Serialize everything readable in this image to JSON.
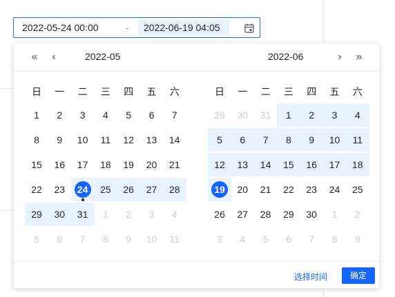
{
  "input": {
    "start": "2022-05-24 00:00",
    "separator": "-",
    "end": "2022-06-19 04:05"
  },
  "nav": {
    "prev_year": "«",
    "prev_month": "‹",
    "next_month": "›",
    "next_year": "»"
  },
  "left_calendar": {
    "title": "2022-05",
    "weekdays": [
      "日",
      "一",
      "二",
      "三",
      "四",
      "五",
      "六"
    ],
    "weeks": [
      [
        {
          "d": "1"
        },
        {
          "d": "2"
        },
        {
          "d": "3"
        },
        {
          "d": "4"
        },
        {
          "d": "5"
        },
        {
          "d": "6"
        },
        {
          "d": "7"
        }
      ],
      [
        {
          "d": "8"
        },
        {
          "d": "9"
        },
        {
          "d": "10"
        },
        {
          "d": "11"
        },
        {
          "d": "12"
        },
        {
          "d": "13"
        },
        {
          "d": "14"
        }
      ],
      [
        {
          "d": "15"
        },
        {
          "d": "16"
        },
        {
          "d": "17"
        },
        {
          "d": "18"
        },
        {
          "d": "19"
        },
        {
          "d": "20"
        },
        {
          "d": "21"
        }
      ],
      [
        {
          "d": "22"
        },
        {
          "d": "23"
        },
        {
          "d": "24",
          "selected": true,
          "today": true
        },
        {
          "d": "25",
          "range": true
        },
        {
          "d": "26",
          "range": true
        },
        {
          "d": "27",
          "range": true
        },
        {
          "d": "28",
          "range": true
        }
      ],
      [
        {
          "d": "29",
          "range": true
        },
        {
          "d": "30",
          "range": true
        },
        {
          "d": "31",
          "range": true
        },
        {
          "d": "1",
          "muted": true
        },
        {
          "d": "2",
          "muted": true
        },
        {
          "d": "3",
          "muted": true
        },
        {
          "d": "4",
          "muted": true
        }
      ],
      [
        {
          "d": "5",
          "muted": true
        },
        {
          "d": "6",
          "muted": true
        },
        {
          "d": "7",
          "muted": true
        },
        {
          "d": "8",
          "muted": true
        },
        {
          "d": "9",
          "muted": true
        },
        {
          "d": "10",
          "muted": true
        },
        {
          "d": "11",
          "muted": true
        }
      ]
    ]
  },
  "right_calendar": {
    "title": "2022-06",
    "weekdays": [
      "日",
      "一",
      "二",
      "三",
      "四",
      "五",
      "六"
    ],
    "weeks": [
      [
        {
          "d": "29",
          "muted": true
        },
        {
          "d": "30",
          "muted": true
        },
        {
          "d": "31",
          "muted": true
        },
        {
          "d": "1",
          "range": true
        },
        {
          "d": "2",
          "range": true
        },
        {
          "d": "3",
          "range": true
        },
        {
          "d": "4",
          "range": true
        }
      ],
      [
        {
          "d": "5",
          "range": true
        },
        {
          "d": "6",
          "range": true
        },
        {
          "d": "7",
          "range": true
        },
        {
          "d": "8",
          "range": true
        },
        {
          "d": "9",
          "range": true
        },
        {
          "d": "10",
          "range": true
        },
        {
          "d": "11",
          "range": true
        }
      ],
      [
        {
          "d": "12",
          "range": true
        },
        {
          "d": "13",
          "range": true
        },
        {
          "d": "14",
          "range": true
        },
        {
          "d": "15",
          "range": true
        },
        {
          "d": "16",
          "range": true
        },
        {
          "d": "17",
          "range": true
        },
        {
          "d": "18",
          "range": true
        }
      ],
      [
        {
          "d": "19",
          "selected": true
        },
        {
          "d": "20"
        },
        {
          "d": "21"
        },
        {
          "d": "22"
        },
        {
          "d": "23"
        },
        {
          "d": "24"
        },
        {
          "d": "25"
        }
      ],
      [
        {
          "d": "26"
        },
        {
          "d": "27"
        },
        {
          "d": "28"
        },
        {
          "d": "29"
        },
        {
          "d": "30"
        },
        {
          "d": "1",
          "muted": true
        },
        {
          "d": "2",
          "muted": true
        }
      ],
      [
        {
          "d": "3",
          "muted": true
        },
        {
          "d": "4",
          "muted": true
        },
        {
          "d": "5",
          "muted": true
        },
        {
          "d": "6",
          "muted": true
        },
        {
          "d": "7",
          "muted": true
        },
        {
          "d": "8",
          "muted": true
        },
        {
          "d": "9",
          "muted": true
        }
      ]
    ]
  },
  "footer": {
    "select_time": "选择时间",
    "confirm": "确定"
  },
  "colors": {
    "accent": "#1664ff",
    "range_bg": "#e8f3ff",
    "muted_text": "#c9cdd4"
  },
  "icons": {
    "calendar": "calendar-icon"
  }
}
